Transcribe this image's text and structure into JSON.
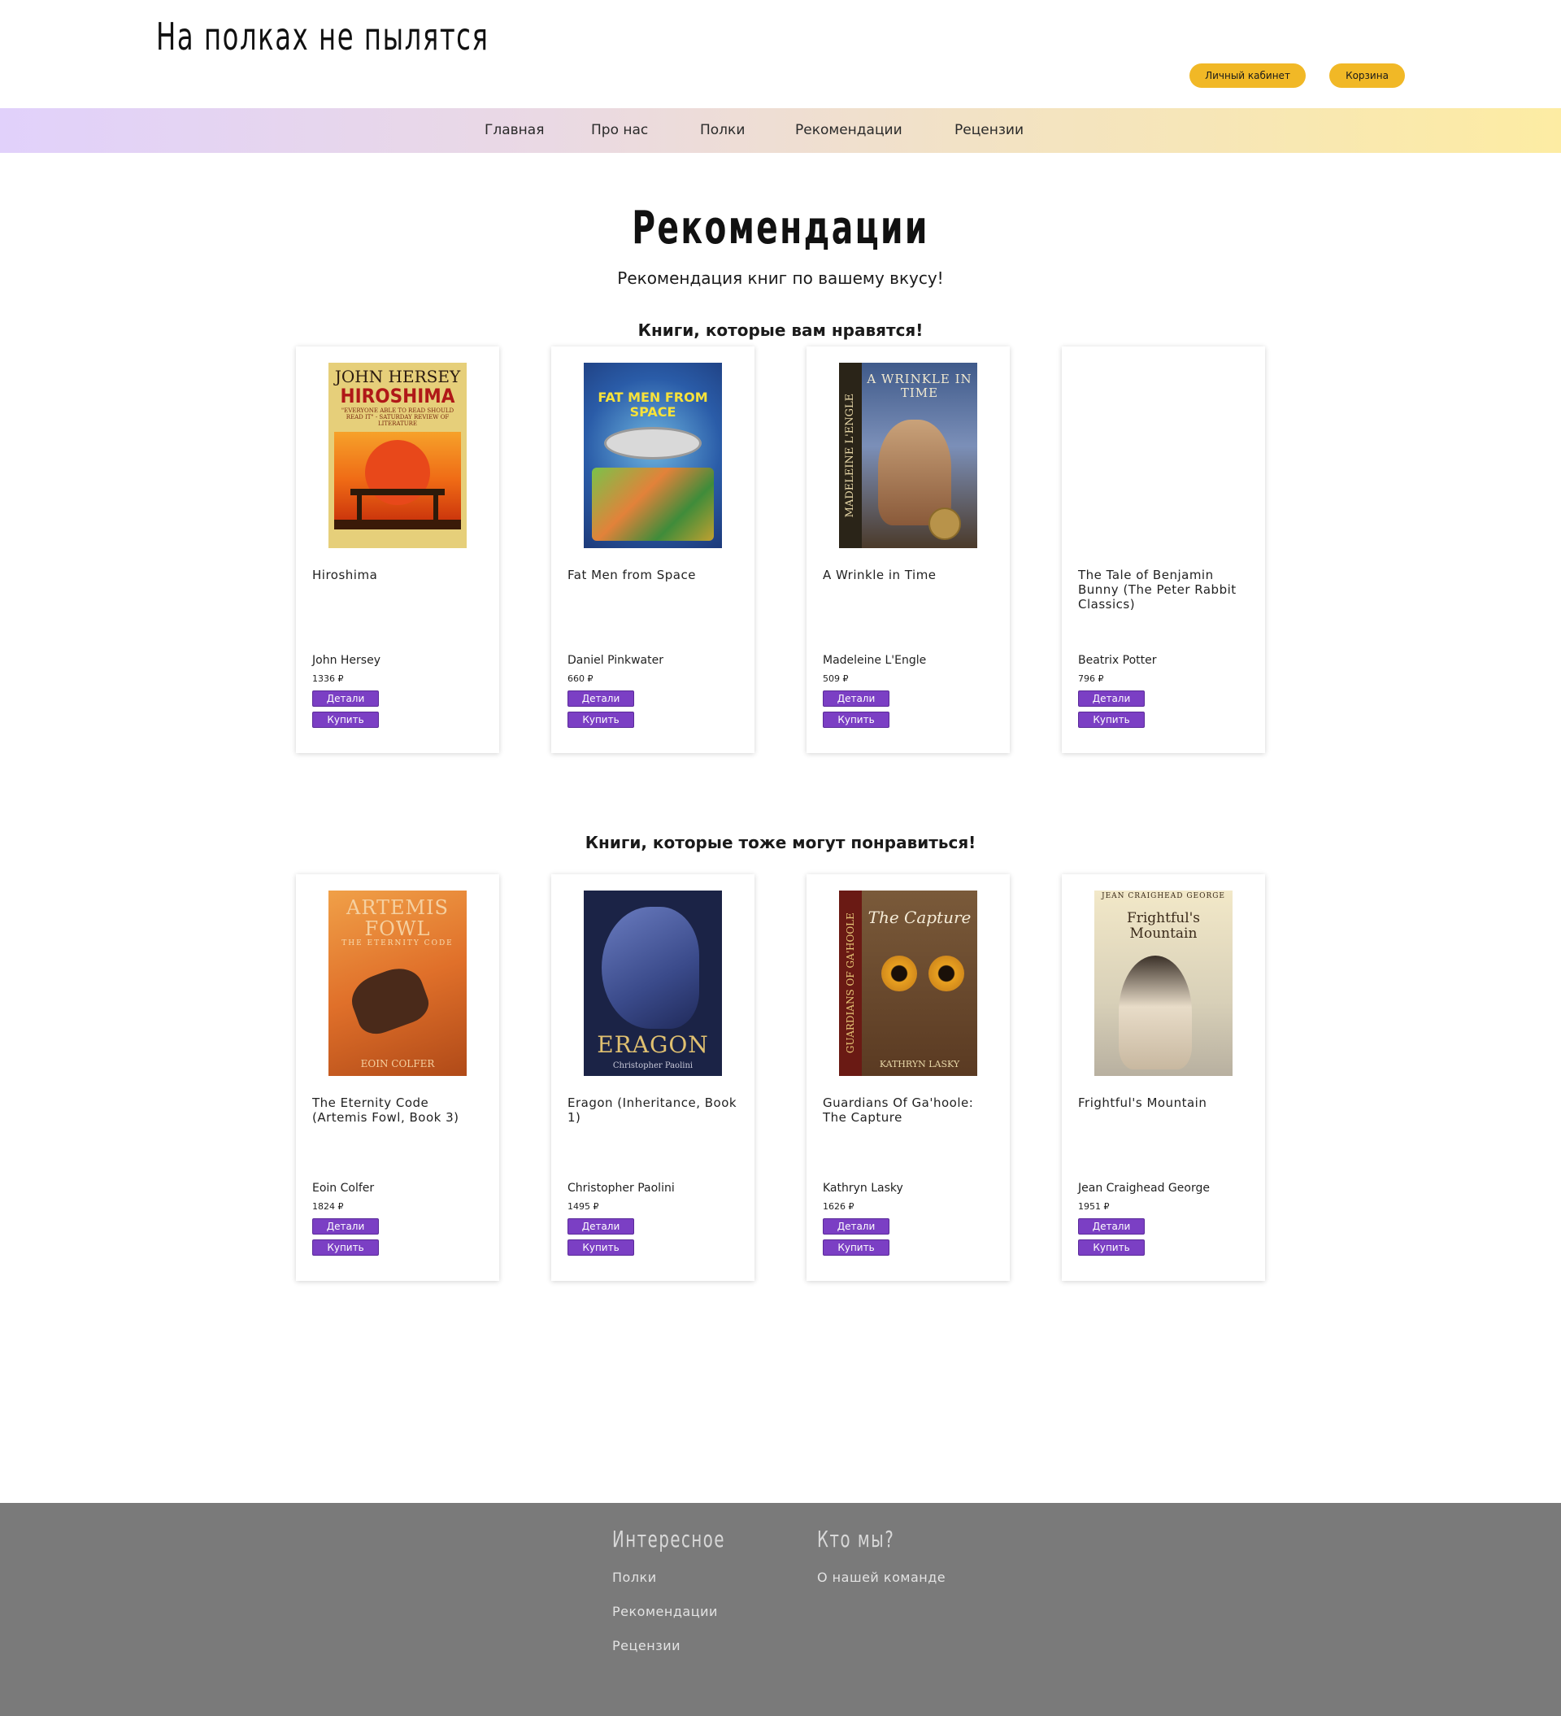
{
  "header": {
    "logo": "На полках не пылятся",
    "account_button": "Личный кабинет",
    "cart_button": "Корзина"
  },
  "nav": {
    "items": [
      "Главная",
      "Про нас",
      "Полки",
      "Рекомендации",
      "Рецензии"
    ]
  },
  "page": {
    "title": "Рекомендации",
    "subtitle": "Рекомендация книг по вашему вкусу!"
  },
  "sections": [
    {
      "title": "Книги, которые вам нравятся!",
      "books": [
        {
          "title": "Hiroshima",
          "author": "John Hersey",
          "price": "1336 ₽",
          "cover": {
            "lines": [
              "JOHN HERSEY",
              "HIROSHIMA",
              "\"EVERYONE ABLE TO READ SHOULD READ IT\" - SATURDAY REVIEW OF LITERATURE"
            ]
          }
        },
        {
          "title": "Fat Men from Space",
          "author": "Daniel Pinkwater",
          "price": "660 ₽",
          "cover": {
            "lines": [
              "FAT MEN FROM SPACE"
            ]
          }
        },
        {
          "title": "A Wrinkle in Time",
          "author": "Madeleine L'Engle",
          "price": "509 ₽",
          "cover": {
            "lines": [
              "A WRINKLE IN TIME",
              "MADELEINE L'ENGLE"
            ]
          }
        },
        {
          "title": "The Tale of Benjamin Bunny (The Peter Rabbit Classics)",
          "author": "Beatrix Potter",
          "price": "796 ₽",
          "cover": {
            "lines": []
          }
        }
      ]
    },
    {
      "title": "Книги, которые тоже могут понравиться!",
      "books": [
        {
          "title": "The Eternity Code (Artemis Fowl, Book 3)",
          "author": "Eoin Colfer",
          "price": "1824 ₽",
          "cover": {
            "lines": [
              "ARTEMIS FOWL",
              "THE ETERNITY CODE",
              "EOIN COLFER"
            ]
          }
        },
        {
          "title": "Eragon (Inheritance, Book 1)",
          "author": "Christopher Paolini",
          "price": "1495 ₽",
          "cover": {
            "lines": [
              "ERAGON",
              "Christopher Paolini"
            ]
          }
        },
        {
          "title": "Guardians Of Ga'hoole: The Capture",
          "author": "Kathryn Lasky",
          "price": "1626 ₽",
          "cover": {
            "lines": [
              "The Capture",
              "GUARDIANS OF GA'HOOLE",
              "KATHRYN LASKY"
            ]
          }
        },
        {
          "title": "Frightful's Mountain",
          "author": "Jean Craighead George",
          "price": "1951 ₽",
          "cover": {
            "lines": [
              "JEAN CRAIGHEAD GEORGE",
              "Frightful's Mountain"
            ]
          }
        }
      ]
    }
  ],
  "card_buttons": {
    "details": "Детали",
    "buy": "Купить"
  },
  "footer": {
    "columns": [
      {
        "heading": "Интересное",
        "links": [
          "Полки",
          "Рекомендации",
          "Рецензии"
        ]
      },
      {
        "heading": "Кто мы?",
        "links": [
          "О нашей команде"
        ]
      }
    ]
  },
  "colors": {
    "accent_button": "#f1b826",
    "card_button": "#7b3fc4",
    "footer_bg": "#7a7a7a"
  }
}
